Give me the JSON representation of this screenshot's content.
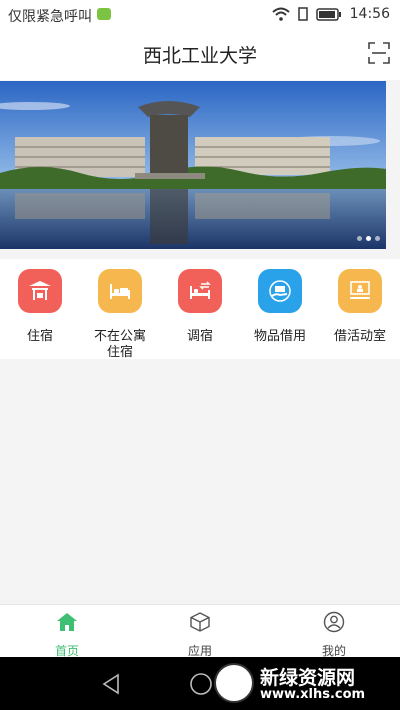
{
  "status_bar": {
    "carrier_text": "仅限紧急呼叫",
    "time": "14:56",
    "icons": [
      "message-badge-icon",
      "wifi-icon",
      "sim-icon",
      "battery-icon"
    ]
  },
  "header": {
    "title": "西北工业大学",
    "right_icon": "scan-icon"
  },
  "banner": {
    "dot_count": 3,
    "active_dot": 1
  },
  "features": [
    {
      "label": "住宿",
      "icon": "lodging-icon",
      "color": "#f2605a"
    },
    {
      "label": "不在公寓\n住宿",
      "icon": "bed-off-icon",
      "color": "#f6b84e"
    },
    {
      "label": "调宿",
      "icon": "bed-swap-icon",
      "color": "#f2605a"
    },
    {
      "label": "物品借用",
      "icon": "item-borrow-icon",
      "color": "#2aa2ea"
    },
    {
      "label": "借活动室",
      "icon": "room-borrow-icon",
      "color": "#f6b84e"
    }
  ],
  "tabbar": {
    "active_color": "#3fbf73",
    "inactive_color": "#444444",
    "tabs": [
      {
        "label": "首页",
        "icon": "home-icon",
        "active": true
      },
      {
        "label": "应用",
        "icon": "apps-box-icon",
        "active": false
      },
      {
        "label": "我的",
        "icon": "profile-icon",
        "active": false
      }
    ]
  },
  "watermark": {
    "brand": "新绿资源网",
    "url": "www.xlhs.com"
  }
}
